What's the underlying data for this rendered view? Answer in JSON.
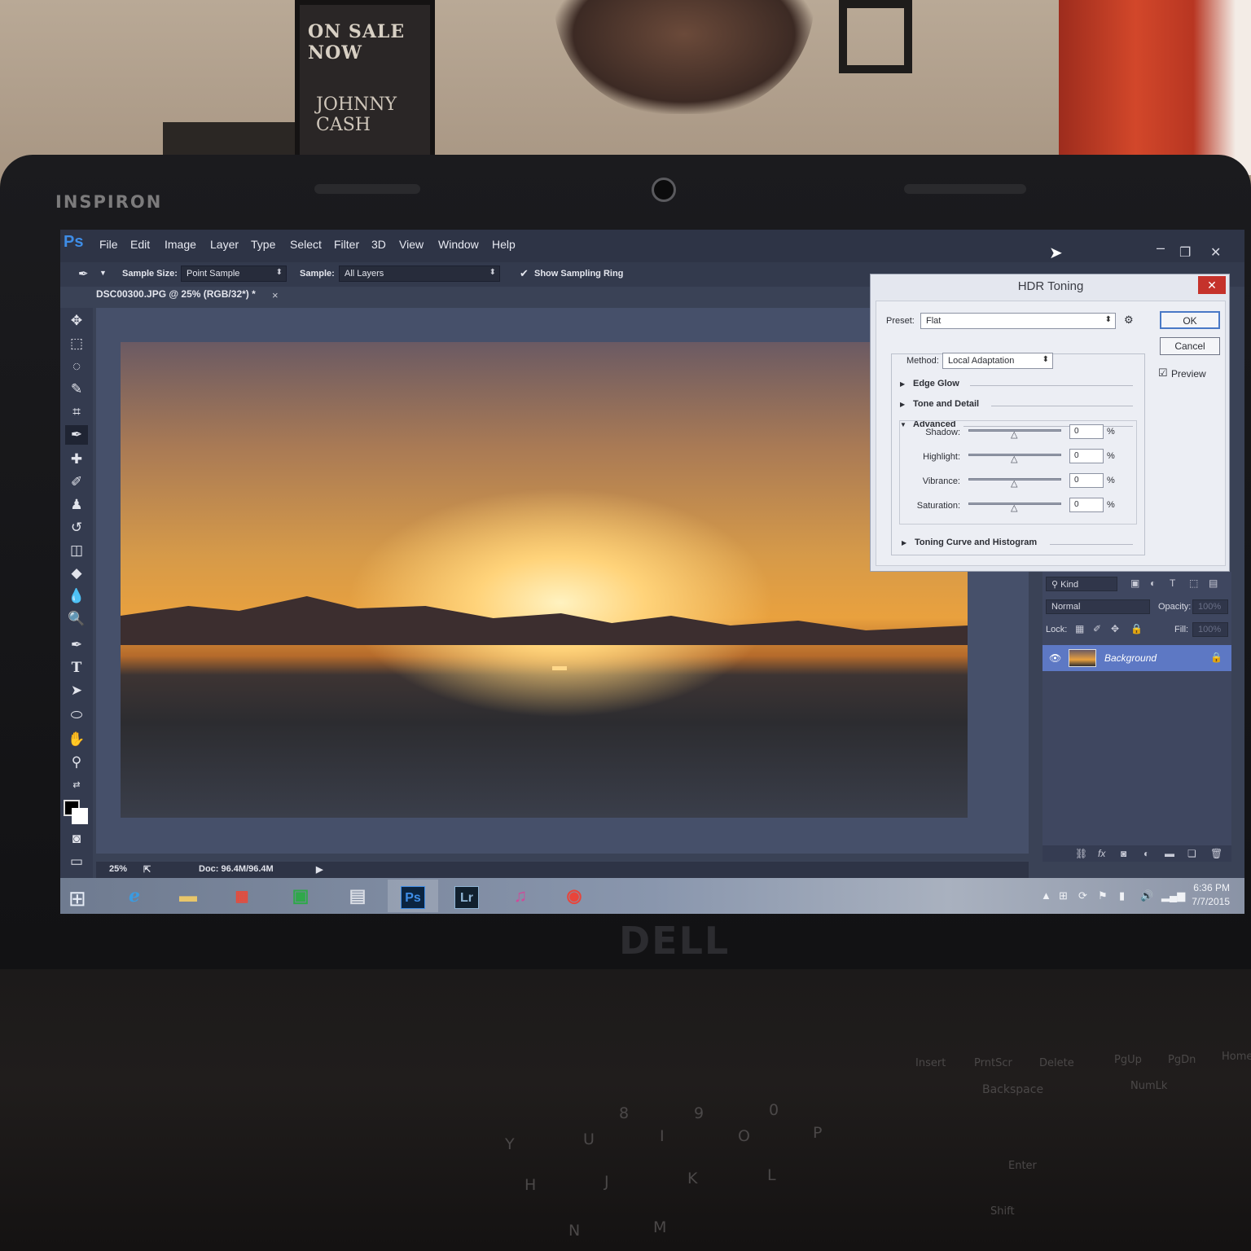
{
  "environment": {
    "poster_text": "ON SALE NOW",
    "poster_name": "JOHNNY CASH",
    "laptop_brand": "INSPIRON",
    "laptop_logo": "DELL"
  },
  "keyboard": {
    "keys": [
      "Insert",
      "PrntScr",
      "Delete",
      "PgUp",
      "PgDn",
      "Home",
      "Backspace",
      "NumLk",
      "8",
      "9",
      "0",
      "U",
      "I",
      "O",
      "P",
      "Y",
      "H",
      "J",
      "K",
      "L",
      "N",
      "M",
      "Enter",
      "Shift"
    ]
  },
  "photoshop": {
    "logo": "Ps",
    "menu": [
      "File",
      "Edit",
      "Image",
      "Layer",
      "Type",
      "Select",
      "Filter",
      "3D",
      "View",
      "Window",
      "Help"
    ],
    "options_bar": {
      "sample_size_label": "Sample Size:",
      "sample_size_value": "Point Sample",
      "sample_label": "Sample:",
      "sample_value": "All Layers",
      "show_ring_label": "Show Sampling Ring",
      "show_ring_checked": true
    },
    "document_tab": "DSC00300.JPG @ 25% (RGB/32*) *",
    "status": {
      "zoom": "25%",
      "doc_size": "Doc: 96.4M/96.4M"
    },
    "layers": {
      "filter_kind": "Kind",
      "blend_mode": "Normal",
      "opacity_label": "Opacity:",
      "opacity_value": "100%",
      "lock_label": "Lock:",
      "fill_label": "Fill:",
      "fill_value": "100%",
      "layer_name": "Background"
    }
  },
  "hdr_dialog": {
    "title": "HDR Toning",
    "preset_label": "Preset:",
    "preset_value": "Flat",
    "ok_label": "OK",
    "cancel_label": "Cancel",
    "preview_label": "Preview",
    "preview_checked": true,
    "method_label": "Method:",
    "method_value": "Local Adaptation",
    "sections": {
      "edge_glow": "Edge Glow",
      "tone_detail": "Tone and Detail",
      "advanced": "Advanced",
      "curve": "Toning Curve and Histogram"
    },
    "sliders": [
      {
        "label": "Shadow:",
        "value": "0",
        "unit": "%",
        "position": 0.5
      },
      {
        "label": "Highlight:",
        "value": "0",
        "unit": "%",
        "position": 0.5
      },
      {
        "label": "Vibrance:",
        "value": "0",
        "unit": "%",
        "position": 0.5
      },
      {
        "label": "Saturation:",
        "value": "0",
        "unit": "%",
        "position": 0.5
      }
    ]
  },
  "taskbar": {
    "time": "6:36 PM",
    "date": "7/7/2015",
    "apps": [
      "internet-explorer",
      "file-explorer",
      "start-apps",
      "store",
      "calculator",
      "Ps",
      "Lr",
      "itunes",
      "chrome"
    ]
  },
  "colors": {
    "ps_blue": "#3e8de7",
    "dialog_close_red": "#c5322b",
    "layer_selected": "#5d78c4"
  }
}
